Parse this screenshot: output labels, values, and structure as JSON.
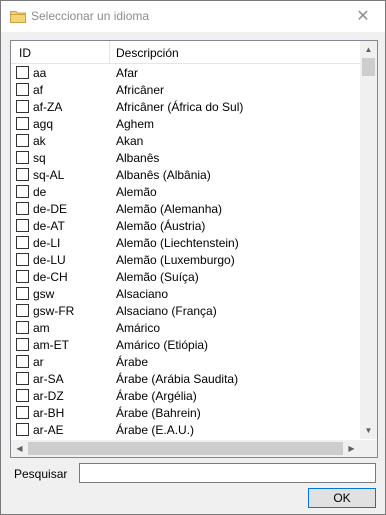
{
  "window": {
    "title": "Seleccionar un idioma",
    "close_glyph": "✕"
  },
  "list": {
    "columns": {
      "id": "ID",
      "description": "Descripción"
    },
    "rows": [
      {
        "id": "aa",
        "description": "Afar"
      },
      {
        "id": "af",
        "description": "Africâner"
      },
      {
        "id": "af-ZA",
        "description": "Africâner (África do Sul)"
      },
      {
        "id": "agq",
        "description": "Aghem"
      },
      {
        "id": "ak",
        "description": "Akan"
      },
      {
        "id": "sq",
        "description": "Albanês"
      },
      {
        "id": "sq-AL",
        "description": "Albanês (Albânia)"
      },
      {
        "id": "de",
        "description": "Alemão"
      },
      {
        "id": "de-DE",
        "description": "Alemão (Alemanha)"
      },
      {
        "id": "de-AT",
        "description": "Alemão (Áustria)"
      },
      {
        "id": "de-LI",
        "description": "Alemão (Liechtenstein)"
      },
      {
        "id": "de-LU",
        "description": "Alemão (Luxemburgo)"
      },
      {
        "id": "de-CH",
        "description": "Alemão (Suíça)"
      },
      {
        "id": "gsw",
        "description": "Alsaciano"
      },
      {
        "id": "gsw-FR",
        "description": "Alsaciano (França)"
      },
      {
        "id": "am",
        "description": "Amárico"
      },
      {
        "id": "am-ET",
        "description": "Amárico (Etiópia)"
      },
      {
        "id": "ar",
        "description": "Árabe"
      },
      {
        "id": "ar-SA",
        "description": "Árabe (Arábia Saudita)"
      },
      {
        "id": "ar-DZ",
        "description": "Árabe (Argélia)"
      },
      {
        "id": "ar-BH",
        "description": "Árabe (Bahrein)"
      },
      {
        "id": "ar-AE",
        "description": "Árabe (E.A.U.)"
      }
    ],
    "scroll": {
      "up": "▲",
      "down": "▼",
      "left": "◀",
      "right": "▶"
    }
  },
  "search": {
    "label": "Pesquisar",
    "value": ""
  },
  "ok_button": {
    "label": "OK"
  },
  "icons": {
    "title_icon": "folder-icon"
  },
  "colors": {
    "accent": "#0078d7",
    "folder": "#e8c15a"
  }
}
